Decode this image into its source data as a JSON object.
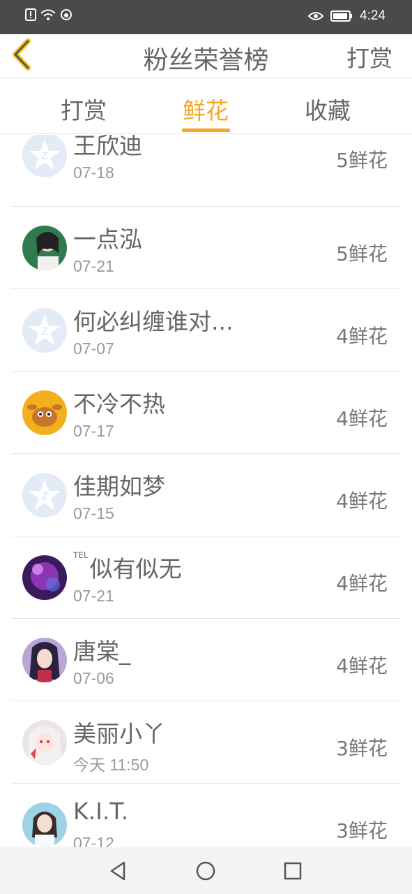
{
  "status_bar": {
    "time": "4:24"
  },
  "nav": {
    "title": "粉丝荣誉榜",
    "action": "打赏"
  },
  "tabs": [
    {
      "label": "打赏",
      "active": false
    },
    {
      "label": "鲜花",
      "active": true
    },
    {
      "label": "收藏",
      "active": false
    }
  ],
  "colors": {
    "accent": "#f5a623",
    "text": "#666666",
    "muted": "#999999"
  },
  "list": [
    {
      "name": "王欣迪",
      "date": "07-18",
      "amount": "5鲜花",
      "avatar": "default-avatar"
    },
    {
      "name": "一点泓",
      "date": "07-21",
      "amount": "5鲜花",
      "avatar": "photo-avatar"
    },
    {
      "name": "何必纠缠谁对...",
      "date": "07-07",
      "amount": "4鲜花",
      "avatar": "default-avatar"
    },
    {
      "name": "不冷不热",
      "date": "07-17",
      "amount": "4鲜花",
      "avatar": "deer-avatar"
    },
    {
      "name": "佳期如梦",
      "date": "07-15",
      "amount": "4鲜花",
      "avatar": "default-avatar"
    },
    {
      "name_prefix": "TEL",
      "name": "似有似无",
      "date": "07-21",
      "amount": "4鲜花",
      "avatar": "purple-avatar"
    },
    {
      "name": "唐棠_",
      "date": "07-06",
      "amount": "4鲜花",
      "avatar": "anime-avatar"
    },
    {
      "name": "美丽小丫",
      "date": "今天 11:50",
      "amount": "3鲜花",
      "avatar": "anime-avatar-2"
    },
    {
      "name": "K.I.T.",
      "date": "07-12",
      "amount": "3鲜花",
      "avatar": "photo-avatar-2"
    }
  ]
}
